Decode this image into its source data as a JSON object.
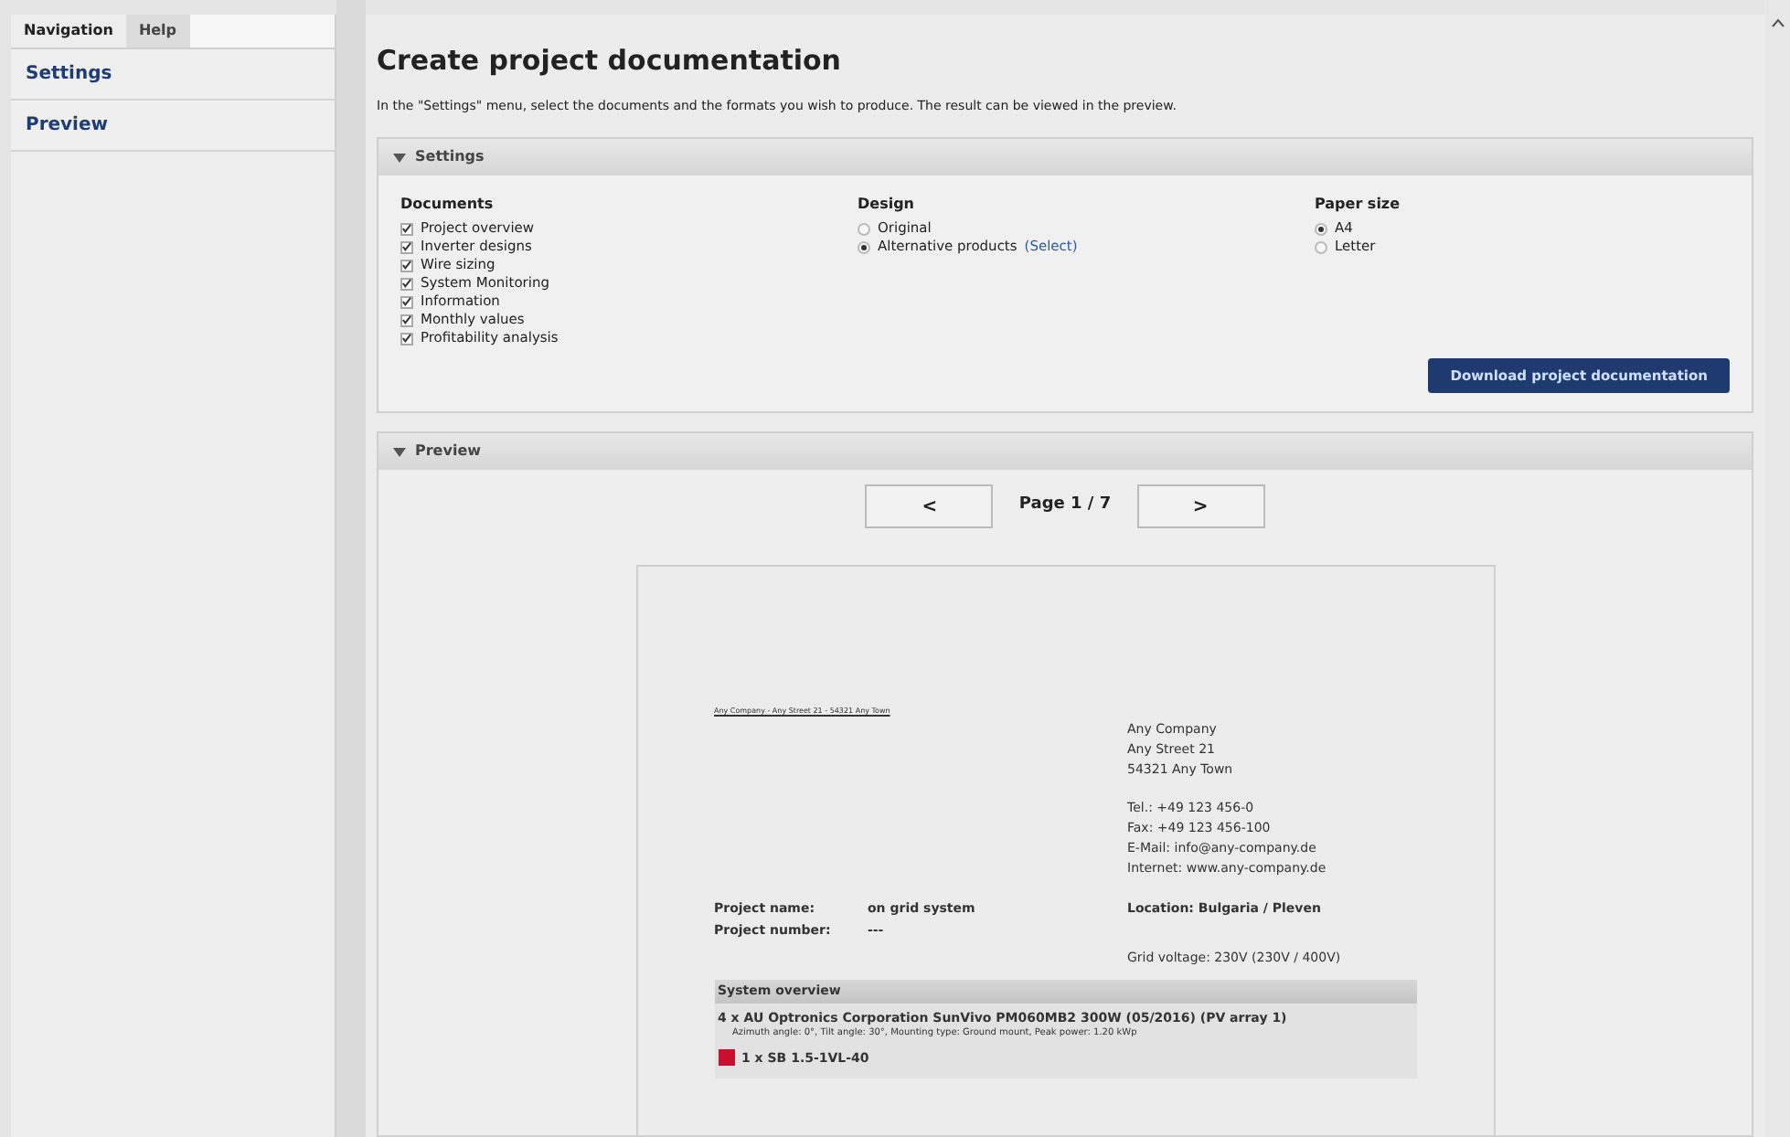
{
  "sidebar": {
    "tabs": [
      {
        "label": "Navigation",
        "selected": true
      },
      {
        "label": "Help",
        "selected": false
      }
    ],
    "items": [
      {
        "label": "Settings",
        "selected": false
      },
      {
        "label": "Preview",
        "selected": false
      }
    ]
  },
  "main": {
    "title": "Create project documentation",
    "intro": "In the \"Settings\" menu, select the documents and the formats you wish to produce. The result can be viewed in the preview.",
    "settings": {
      "header": "Settings",
      "expanded": true,
      "documents": {
        "heading": "Documents",
        "items": [
          {
            "label": "Project overview",
            "checked": true
          },
          {
            "label": "Inverter designs",
            "checked": true
          },
          {
            "label": "Wire sizing",
            "checked": true
          },
          {
            "label": "System Monitoring",
            "checked": true
          },
          {
            "label": "Information",
            "checked": true
          },
          {
            "label": "Monthly values",
            "checked": true
          },
          {
            "label": "Profitability analysis",
            "checked": true
          }
        ]
      },
      "design": {
        "heading": "Design",
        "options": [
          {
            "label": "Original",
            "selected": false
          },
          {
            "label": "Alternative products",
            "link": "(Select)",
            "selected": true
          }
        ]
      },
      "paper": {
        "heading": "Paper size",
        "options": [
          {
            "label": "A4",
            "selected": true
          },
          {
            "label": "Letter",
            "selected": false
          }
        ]
      },
      "download_button": "Download project documentation"
    },
    "preview": {
      "header": "Preview",
      "expanded": true,
      "prev_button": "<",
      "page_label": "Page 1 / 7",
      "next_button": ">",
      "document": {
        "sender_line": "Any Company - Any Street 21 - 54321 Any Town",
        "address": [
          "Any Company",
          "Any Street 21",
          "54321 Any Town"
        ],
        "contact": [
          "Tel.: +49 123 456-0",
          "Fax: +49 123 456-100",
          "E-Mail: info@any-company.de",
          "Internet: www.any-company.de"
        ],
        "project_name_label": "Project name:",
        "project_name": "on grid system",
        "location": "Location: Bulgaria / Pleven",
        "project_number_label": "Project number:",
        "project_number": "---",
        "grid_voltage": "Grid voltage: 230V (230V / 400V)",
        "section": "System overview",
        "module": "4 x AU Optronics Corporation SunVivo PM060MB2 300W (05/2016) (PV array 1)",
        "module_detail": "Azimuth angle: 0°, Tilt angle: 30°, Mounting type: Ground mount, Peak power: 1.20 kWp",
        "inverter": "1 x SB 1.5-1VL-40"
      }
    }
  }
}
